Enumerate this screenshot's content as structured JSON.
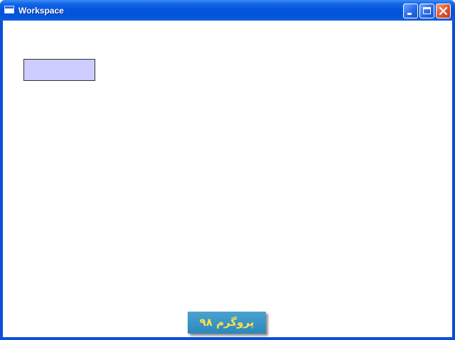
{
  "window": {
    "title": "Workspace",
    "icon": "window-app-icon",
    "controls": {
      "minimize": "minimize-icon",
      "maximize": "maximize-icon",
      "close": "close-icon"
    }
  },
  "canvas": {
    "shape": {
      "kind": "rectangle",
      "fill": "#ccccff",
      "stroke": "#333333"
    }
  },
  "watermark": {
    "text": "پروگرم ۹۸",
    "background": "#2c87bb",
    "color": "#ffe14a"
  },
  "colors": {
    "titlebar": "#0254d8",
    "close_button": "#e0532c"
  }
}
